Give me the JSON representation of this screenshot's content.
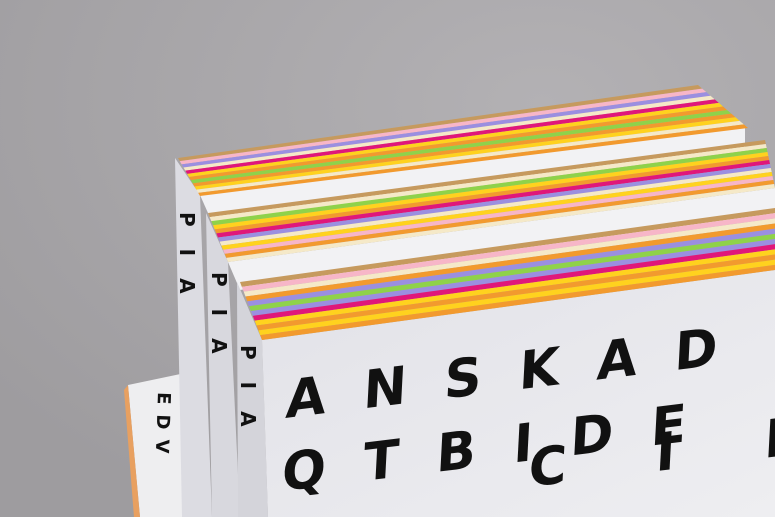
{
  "scene": "photo",
  "front_cover": {
    "row1": "ANSKAD",
    "row2": "QTBIDE",
    "row3": "CIF"
  },
  "spine_letters": "PIA",
  "small_book_letters": "EDV",
  "colors": {
    "background": "#a8a6a9",
    "cover": "#e6e6ea",
    "stripes": [
      "#f29a2e",
      "#ffd21e",
      "#e0177a",
      "#8fd24a",
      "#9b8fe0",
      "#f7b6c8",
      "#f5e9c8",
      "#c69a5e"
    ]
  }
}
